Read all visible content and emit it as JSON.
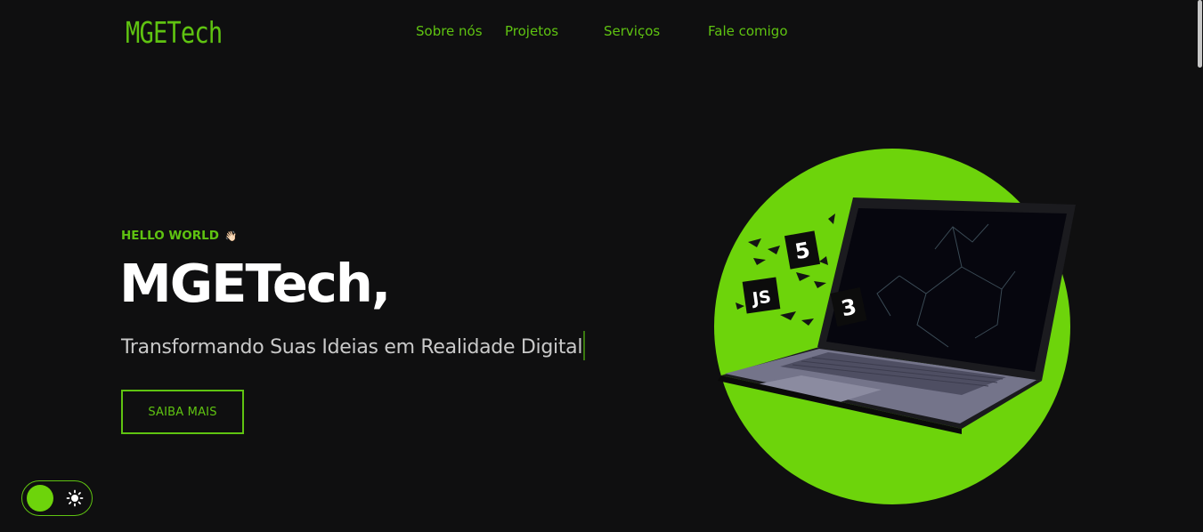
{
  "brand": {
    "logo_text": "MGETech"
  },
  "nav": {
    "items": [
      {
        "label": "Sobre nós"
      },
      {
        "label": "Projetos"
      },
      {
        "label": "Serviços"
      },
      {
        "label": "Fale comigo"
      }
    ]
  },
  "hero": {
    "tagline": "HELLO WORLD",
    "tagline_emoji": "👋🏻",
    "title": "MGETech,",
    "subtitle": "Transformando Suas Ideias em Realidade Digital",
    "cta_label": "SAIBA MAIS"
  },
  "illustration": {
    "badges": [
      {
        "text": "5"
      },
      {
        "text": "JS"
      },
      {
        "text": "3"
      }
    ]
  },
  "theme_toggle": {
    "icon": "sun-icon"
  },
  "colors": {
    "background": "#0f0f10",
    "accent": "#5fc311",
    "circle": "#6dd40b",
    "heading": "#ffffff",
    "subtitle": "#c9c9c9"
  }
}
